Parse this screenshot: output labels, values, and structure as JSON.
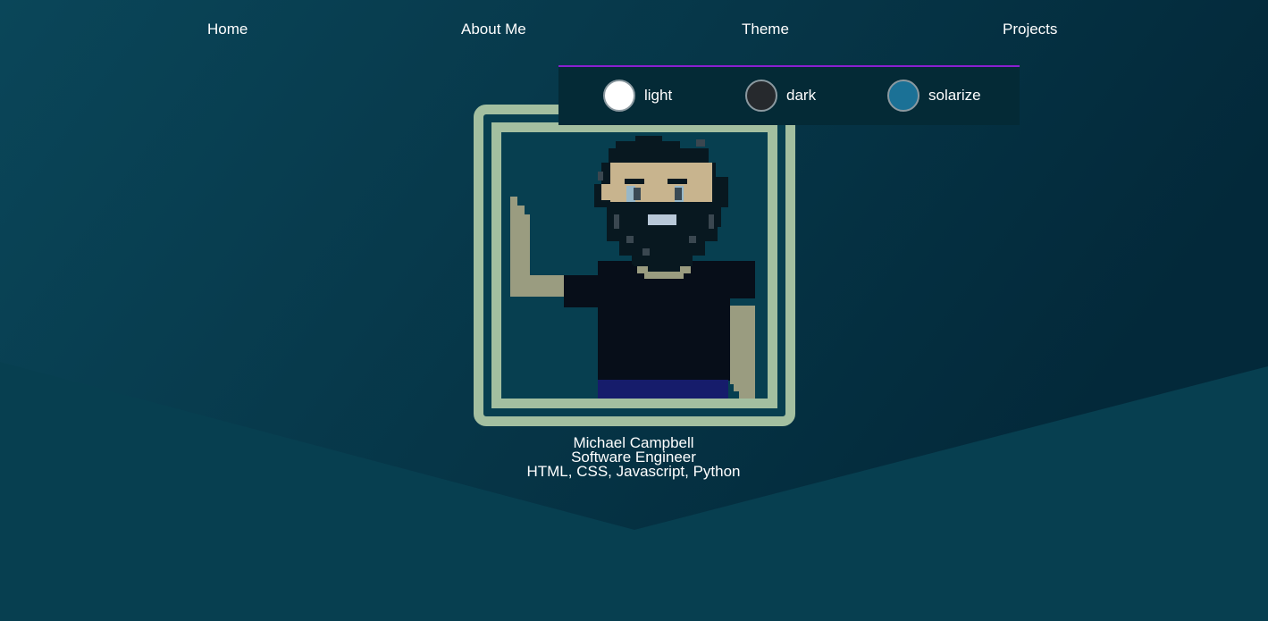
{
  "nav": {
    "items": [
      {
        "label": "Home"
      },
      {
        "label": "About Me"
      },
      {
        "label": "Theme"
      },
      {
        "label": "Projects"
      }
    ]
  },
  "theme_menu": {
    "accent_color": "#8a1fd1",
    "options": [
      {
        "label": "light",
        "swatch_color": "#ffffff"
      },
      {
        "label": "dark",
        "swatch_color": "#26292d"
      },
      {
        "label": "solarize",
        "swatch_color": "#1b7196"
      }
    ]
  },
  "profile": {
    "name": "Michael Campbell",
    "title": "Software Engineer",
    "skills": "HTML, CSS, Javascript, Python"
  },
  "colors": {
    "background": "#073f50",
    "frame": "#a3bfa0",
    "text": "#ffffff"
  }
}
